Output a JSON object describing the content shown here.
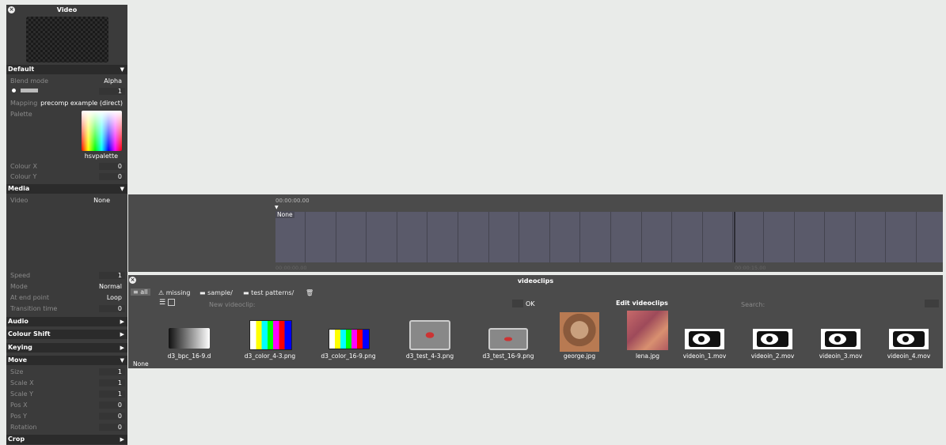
{
  "video_panel": {
    "title": "Video",
    "default": {
      "header": "Default",
      "blend_mode_label": "Blend mode",
      "blend_mode_value": "Alpha",
      "brightness_value": "1",
      "mapping_label": "Mapping",
      "mapping_value": "precomp example (direct)",
      "palette_label": "Palette",
      "palette_name": "hsvpalette",
      "colour_x_label": "Colour X",
      "colour_x_value": "0",
      "colour_y_label": "Colour Y",
      "colour_y_value": "0"
    },
    "media": {
      "header": "Media",
      "video_label": "Video",
      "video_value": "None",
      "speed_label": "Speed",
      "speed_value": "1",
      "mode_label": "Mode",
      "mode_value": "Normal",
      "end_point_label": "At end point",
      "end_point_value": "Loop",
      "transition_label": "Transition time",
      "transition_value": "0"
    },
    "collapsed": {
      "audio": "Audio",
      "colour_shift": "Colour Shift",
      "keying": "Keying",
      "crop": "Crop"
    },
    "move": {
      "header": "Move",
      "size_label": "Size",
      "size_value": "1",
      "scale_x_label": "Scale X",
      "scale_x_value": "1",
      "scale_y_label": "Scale Y",
      "scale_y_value": "1",
      "pos_x_label": "Pos X",
      "pos_x_value": "0",
      "pos_y_label": "Pos Y",
      "pos_y_value": "0",
      "rotation_label": "Rotation",
      "rotation_value": "0"
    }
  },
  "timeline": {
    "timecode_top": "00:00:00.00",
    "clip_label": "None",
    "timecode_start": "00:00:00.00",
    "timecode_mid": "00:00:15.00"
  },
  "browser": {
    "title": "videoclips",
    "tabs": {
      "all": "all",
      "missing": "missing",
      "sample": "sample/",
      "test_patterns": "test patterns/"
    },
    "new_label": "New videoclip:",
    "ok_label": "OK",
    "edit_label": "Edit videoclips",
    "search_label": "Search:",
    "none_label": "None",
    "clips": [
      "d3_bpc_16-9.d",
      "d3_color_4-3.png",
      "d3_color_16-9.png",
      "d3_test_4-3.png",
      "d3_test_16-9.png",
      "george.jpg",
      "lena.jpg",
      "videoin_1.mov",
      "videoin_2.mov",
      "videoin_3.mov",
      "videoin_4.mov"
    ]
  },
  "colors": {
    "panel_bg": "#3b3b3b",
    "section_bg": "#2b2b2b",
    "timeline_bg": "#4b4b4b",
    "strip": "#5a5a6a"
  }
}
